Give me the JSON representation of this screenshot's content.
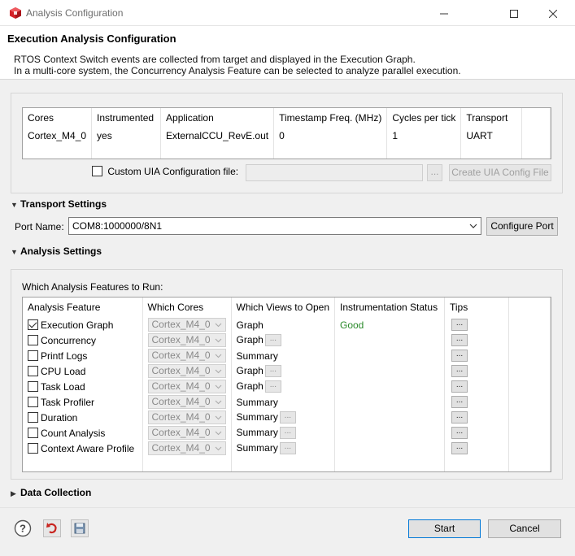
{
  "window": {
    "title": "Analysis Configuration",
    "icon": "ti-cube-icon",
    "accent_color": "#d42027"
  },
  "header": {
    "title": "Execution Analysis Configuration",
    "desc_line1": "RTOS Context Switch events are collected from target and displayed in the Execution Graph.",
    "desc_line2": "In a multi-core system, the Concurrency Analysis Feature can be selected to analyze parallel execution."
  },
  "cores_table": {
    "columns": [
      "Cores",
      "Instrumented",
      "Application",
      "Timestamp Freq. (MHz)",
      "Cycles per tick",
      "Transport"
    ],
    "rows": [
      [
        "Cortex_M4_0",
        "yes",
        "ExternalCCU_RevE.out",
        "0",
        "1",
        "UART"
      ]
    ]
  },
  "custom_uia": {
    "label": "Custom UIA Configuration file:",
    "checked": false,
    "value": "",
    "browse_label": "...",
    "create_label": "Create UIA Config File"
  },
  "transport": {
    "section_label": "Transport Settings",
    "port_label": "Port Name:",
    "port_value": "COM8:1000000/8N1",
    "configure_label": "Configure Port"
  },
  "analysis": {
    "section_label": "Analysis Settings",
    "features_label": "Which Analysis Features to Run:",
    "columns": [
      "Analysis Feature",
      "Which Cores",
      "Which Views to Open",
      "Instrumentation Status",
      "Tips"
    ],
    "status_good_color": "#2a8a2a",
    "rows": [
      {
        "feature": "Execution Graph",
        "checked": true,
        "core": "Cortex_M4_0",
        "view": "Graph",
        "view_btn": false,
        "status": "Good",
        "tip": "..."
      },
      {
        "feature": "Concurrency",
        "checked": false,
        "core": "Cortex_M4_0",
        "view": "Graph",
        "view_btn": true,
        "status": "",
        "tip": "..."
      },
      {
        "feature": "Printf Logs",
        "checked": false,
        "core": "Cortex_M4_0",
        "view": "Summary",
        "view_btn": false,
        "status": "",
        "tip": "..."
      },
      {
        "feature": "CPU Load",
        "checked": false,
        "core": "Cortex_M4_0",
        "view": "Graph",
        "view_btn": true,
        "status": "",
        "tip": "..."
      },
      {
        "feature": "Task Load",
        "checked": false,
        "core": "Cortex_M4_0",
        "view": "Graph",
        "view_btn": true,
        "status": "",
        "tip": "..."
      },
      {
        "feature": "Task Profiler",
        "checked": false,
        "core": "Cortex_M4_0",
        "view": "Summary",
        "view_btn": false,
        "status": "",
        "tip": "..."
      },
      {
        "feature": "Duration",
        "checked": false,
        "core": "Cortex_M4_0",
        "view": "Summary",
        "view_btn": true,
        "status": "",
        "tip": "..."
      },
      {
        "feature": "Count Analysis",
        "checked": false,
        "core": "Cortex_M4_0",
        "view": "Summary",
        "view_btn": true,
        "status": "",
        "tip": "..."
      },
      {
        "feature": "Context Aware Profile",
        "checked": false,
        "core": "Cortex_M4_0",
        "view": "Summary",
        "view_btn": true,
        "status": "",
        "tip": "..."
      }
    ],
    "view_btn_label": "..."
  },
  "data_collection": {
    "section_label": "Data Collection"
  },
  "footer": {
    "start_label": "Start",
    "cancel_label": "Cancel"
  }
}
